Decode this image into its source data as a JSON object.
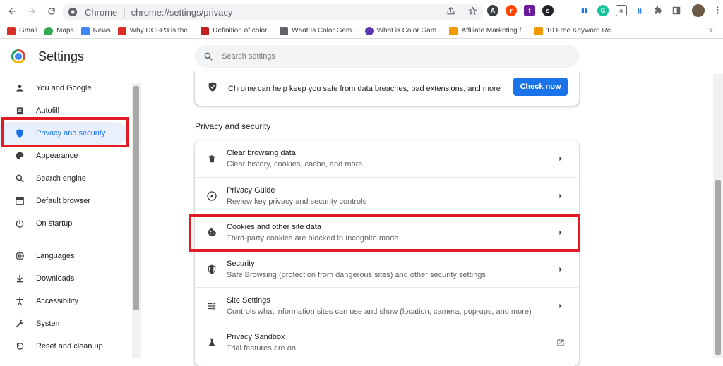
{
  "browser": {
    "omnibox_host": "Chrome",
    "omnibox_path": "chrome://settings/privacy",
    "bookmarks": [
      {
        "label": "Gmail",
        "icon": "gmail-icon",
        "color": "#d93025"
      },
      {
        "label": "Maps",
        "icon": "maps-icon",
        "color": "#34a853"
      },
      {
        "label": "News",
        "icon": "news-icon",
        "color": "#4285f4"
      },
      {
        "label": "Why DCI-P3 is the...",
        "icon": "shield-red-icon",
        "color": "#d93025"
      },
      {
        "label": "Definition of color...",
        "icon": "pc-icon",
        "color": "#c5221f"
      },
      {
        "label": "What Is Color Gam...",
        "icon": "car-icon",
        "color": "#5f6368"
      },
      {
        "label": "What is Color Gam...",
        "icon": "purple-icon",
        "color": "#5e35b1"
      },
      {
        "label": "Affiliate Marketing f...",
        "icon": "b-icon",
        "color": "#f29900"
      },
      {
        "label": "10 Free Keyword Re...",
        "icon": "b-icon",
        "color": "#f29900"
      }
    ],
    "bookmarks_more": "»"
  },
  "header": {
    "title": "Settings",
    "search_placeholder": "Search settings"
  },
  "sidebar": {
    "items": [
      {
        "label": "You and Google",
        "icon": "person-icon"
      },
      {
        "label": "Autofill",
        "icon": "clipboard-icon"
      },
      {
        "label": "Privacy and security",
        "icon": "shield-icon"
      },
      {
        "label": "Appearance",
        "icon": "palette-icon"
      },
      {
        "label": "Search engine",
        "icon": "search-icon"
      },
      {
        "label": "Default browser",
        "icon": "browser-icon"
      },
      {
        "label": "On startup",
        "icon": "power-icon"
      },
      {
        "label": "Languages",
        "icon": "globe-icon"
      },
      {
        "label": "Downloads",
        "icon": "download-icon"
      },
      {
        "label": "Accessibility",
        "icon": "accessibility-icon"
      },
      {
        "label": "System",
        "icon": "wrench-icon"
      },
      {
        "label": "Reset and clean up",
        "icon": "restore-icon"
      }
    ],
    "active_index": 2
  },
  "safety": {
    "text": "Chrome can help keep you safe from data breaches, bad extensions, and more",
    "button": "Check now"
  },
  "privacy": {
    "section_title": "Privacy and security",
    "rows": [
      {
        "title": "Clear browsing data",
        "subtitle": "Clear history, cookies, cache, and more",
        "icon": "trash-icon"
      },
      {
        "title": "Privacy Guide",
        "subtitle": "Review key privacy and security controls",
        "icon": "compass-icon"
      },
      {
        "title": "Cookies and other site data",
        "subtitle": "Third-party cookies are blocked in Incognito mode",
        "icon": "cookie-icon"
      },
      {
        "title": "Security",
        "subtitle": "Safe Browsing (protection from dangerous sites) and other security settings",
        "icon": "shield-icon"
      },
      {
        "title": "Site Settings",
        "subtitle": "Controls what information sites can use and show (location, camera, pop-ups, and more)",
        "icon": "tune-icon"
      },
      {
        "title": "Privacy Sandbox",
        "subtitle": "Trial features are on",
        "icon": "flask-icon"
      }
    ]
  },
  "colors": {
    "accent": "#1a73e8",
    "active_bg": "#e8f0fe",
    "highlight": "#e21a23"
  }
}
